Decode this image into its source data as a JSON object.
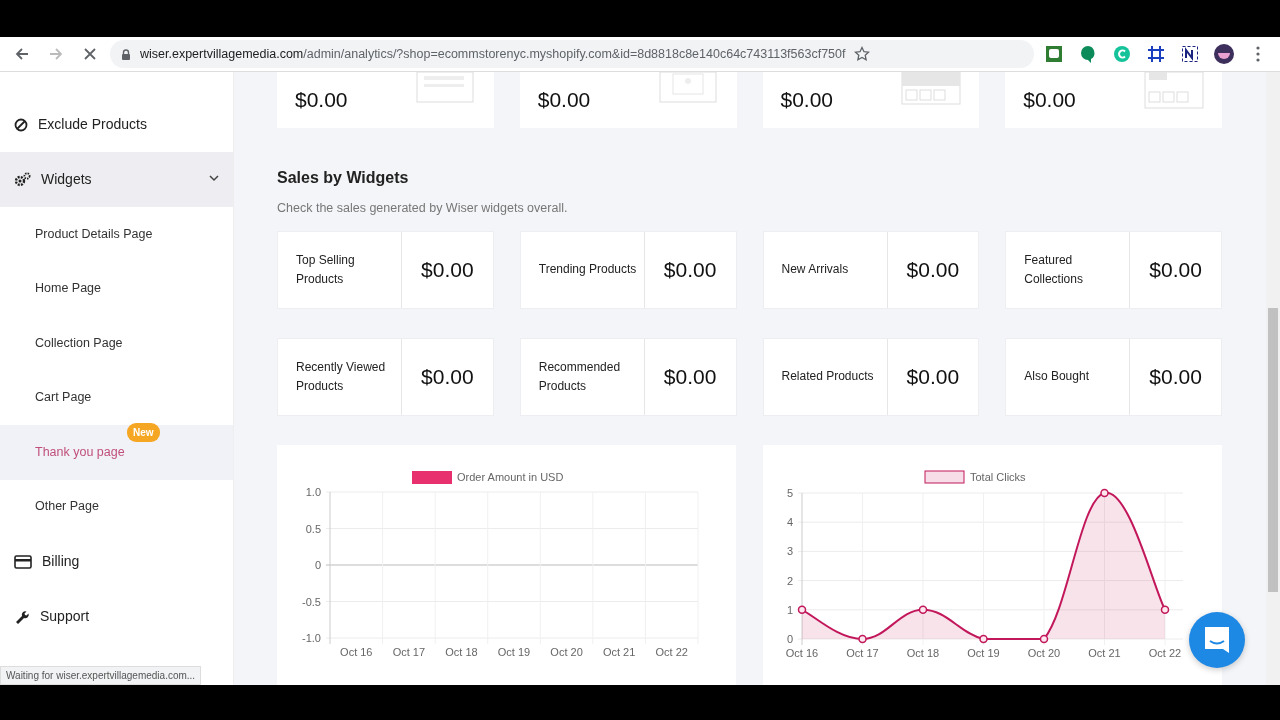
{
  "browser": {
    "url_host": "wiser.expertvillagemedia.com",
    "url_path": "/admin/analytics/?shop=ecommstorenyc.myshopify.com&id=8d8818c8e140c64c743113f563cf750f",
    "loading": true
  },
  "sidebar": {
    "items": [
      {
        "kind": "item",
        "label": "Exclude Products",
        "selected": false
      },
      {
        "kind": "item",
        "label": "Widgets",
        "selected": true,
        "expanded": true,
        "children": [
          {
            "label": "Product Details Page",
            "highlighted": false
          },
          {
            "label": "Home Page",
            "highlighted": false
          },
          {
            "label": "Collection Page",
            "highlighted": false
          },
          {
            "label": "Cart Page",
            "highlighted": false
          },
          {
            "label": "Thank you page",
            "highlighted": true,
            "badge": "New"
          },
          {
            "label": "Other Page",
            "highlighted": false
          }
        ]
      },
      {
        "kind": "item",
        "label": "Billing",
        "selected": false
      },
      {
        "kind": "item",
        "label": "Support",
        "selected": false
      }
    ]
  },
  "summary_cards": [
    {
      "value": "$0.00"
    },
    {
      "value": "$0.00"
    },
    {
      "value": "$0.00"
    },
    {
      "value": "$0.00"
    }
  ],
  "sales_by_widgets": {
    "title": "Sales by Widgets",
    "subtitle": "Check the sales generated by Wiser widgets overall.",
    "cards": [
      {
        "label": "Top Selling Products",
        "value": "$0.00"
      },
      {
        "label": "Trending Products",
        "value": "$0.00"
      },
      {
        "label": "New Arrivals",
        "value": "$0.00"
      },
      {
        "label": "Featured Collections",
        "value": "$0.00"
      },
      {
        "label": "Recently Viewed Products",
        "value": "$0.00"
      },
      {
        "label": "Recommended Products",
        "value": "$0.00"
      },
      {
        "label": "Related Products",
        "value": "$0.00"
      },
      {
        "label": "Also Bought",
        "value": "$0.00"
      }
    ]
  },
  "charts": [
    {
      "chart_data": {
        "type": "bar",
        "categories": [
          "Oct 16",
          "Oct 17",
          "Oct 18",
          "Oct 19",
          "Oct 20",
          "Oct 21",
          "Oct 22"
        ],
        "series": [
          {
            "name": "Order Amount in USD",
            "color": "#e8306e",
            "values": [
              null,
              null,
              null,
              null,
              null,
              null,
              null
            ]
          }
        ],
        "grid": true,
        "ylim": [
          -1,
          1
        ],
        "yticks": [
          {
            "value": 1,
            "label": "1.0"
          },
          0.5,
          0,
          -0.5,
          {
            "value": -1,
            "label": "-1.0"
          }
        ]
      }
    },
    {
      "chart_data": {
        "type": "area",
        "categories": [
          "Oct 16",
          "Oct 17",
          "Oct 18",
          "Oct 19",
          "Oct 20",
          "Oct 21",
          "Oct 22"
        ],
        "series": [
          {
            "name": "Total Clicks",
            "color": "#c2185b",
            "values": [
              1,
              0,
              1,
              0,
              0,
              5,
              1
            ]
          }
        ],
        "grid": true,
        "ylim": [
          0,
          5
        ],
        "yticks": [
          0,
          1,
          2,
          3,
          4,
          5
        ]
      }
    }
  ],
  "status_bar": "Waiting for wiser.expertvillagemedia.com..."
}
